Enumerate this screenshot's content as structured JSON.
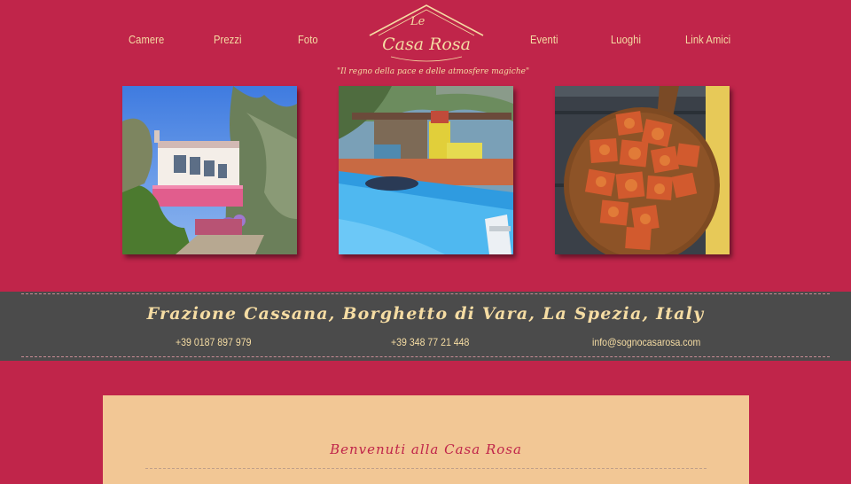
{
  "nav": {
    "left": [
      {
        "label": "Camere"
      },
      {
        "label": "Prezzi"
      },
      {
        "label": "Foto"
      }
    ],
    "right": [
      {
        "label": "Eventi"
      },
      {
        "label": "Luoghi"
      },
      {
        "label": "Link Amici"
      }
    ]
  },
  "logo": {
    "line1": "Le",
    "line2": "Casa Rosa"
  },
  "tagline": "\"Il regno della pace e delle atmosfere magiche\"",
  "photos": [
    {
      "subject": "house-photo"
    },
    {
      "subject": "pool-photo"
    },
    {
      "subject": "pizza-photo"
    }
  ],
  "contact": {
    "address": "Frazione Cassana, Borghetto di Vara, La Spezia, Italy",
    "phone1": "+39 0187 897 979",
    "phone2": "+39 348 77 21 448",
    "email": "info@sognocasarosa.com"
  },
  "content": {
    "welcome": "Benvenuti alla Casa Rosa"
  },
  "colors": {
    "background": "#c0254a",
    "accent_text": "#f5dca3",
    "band": "#4b4b4b",
    "content_bg": "#f2c795"
  }
}
